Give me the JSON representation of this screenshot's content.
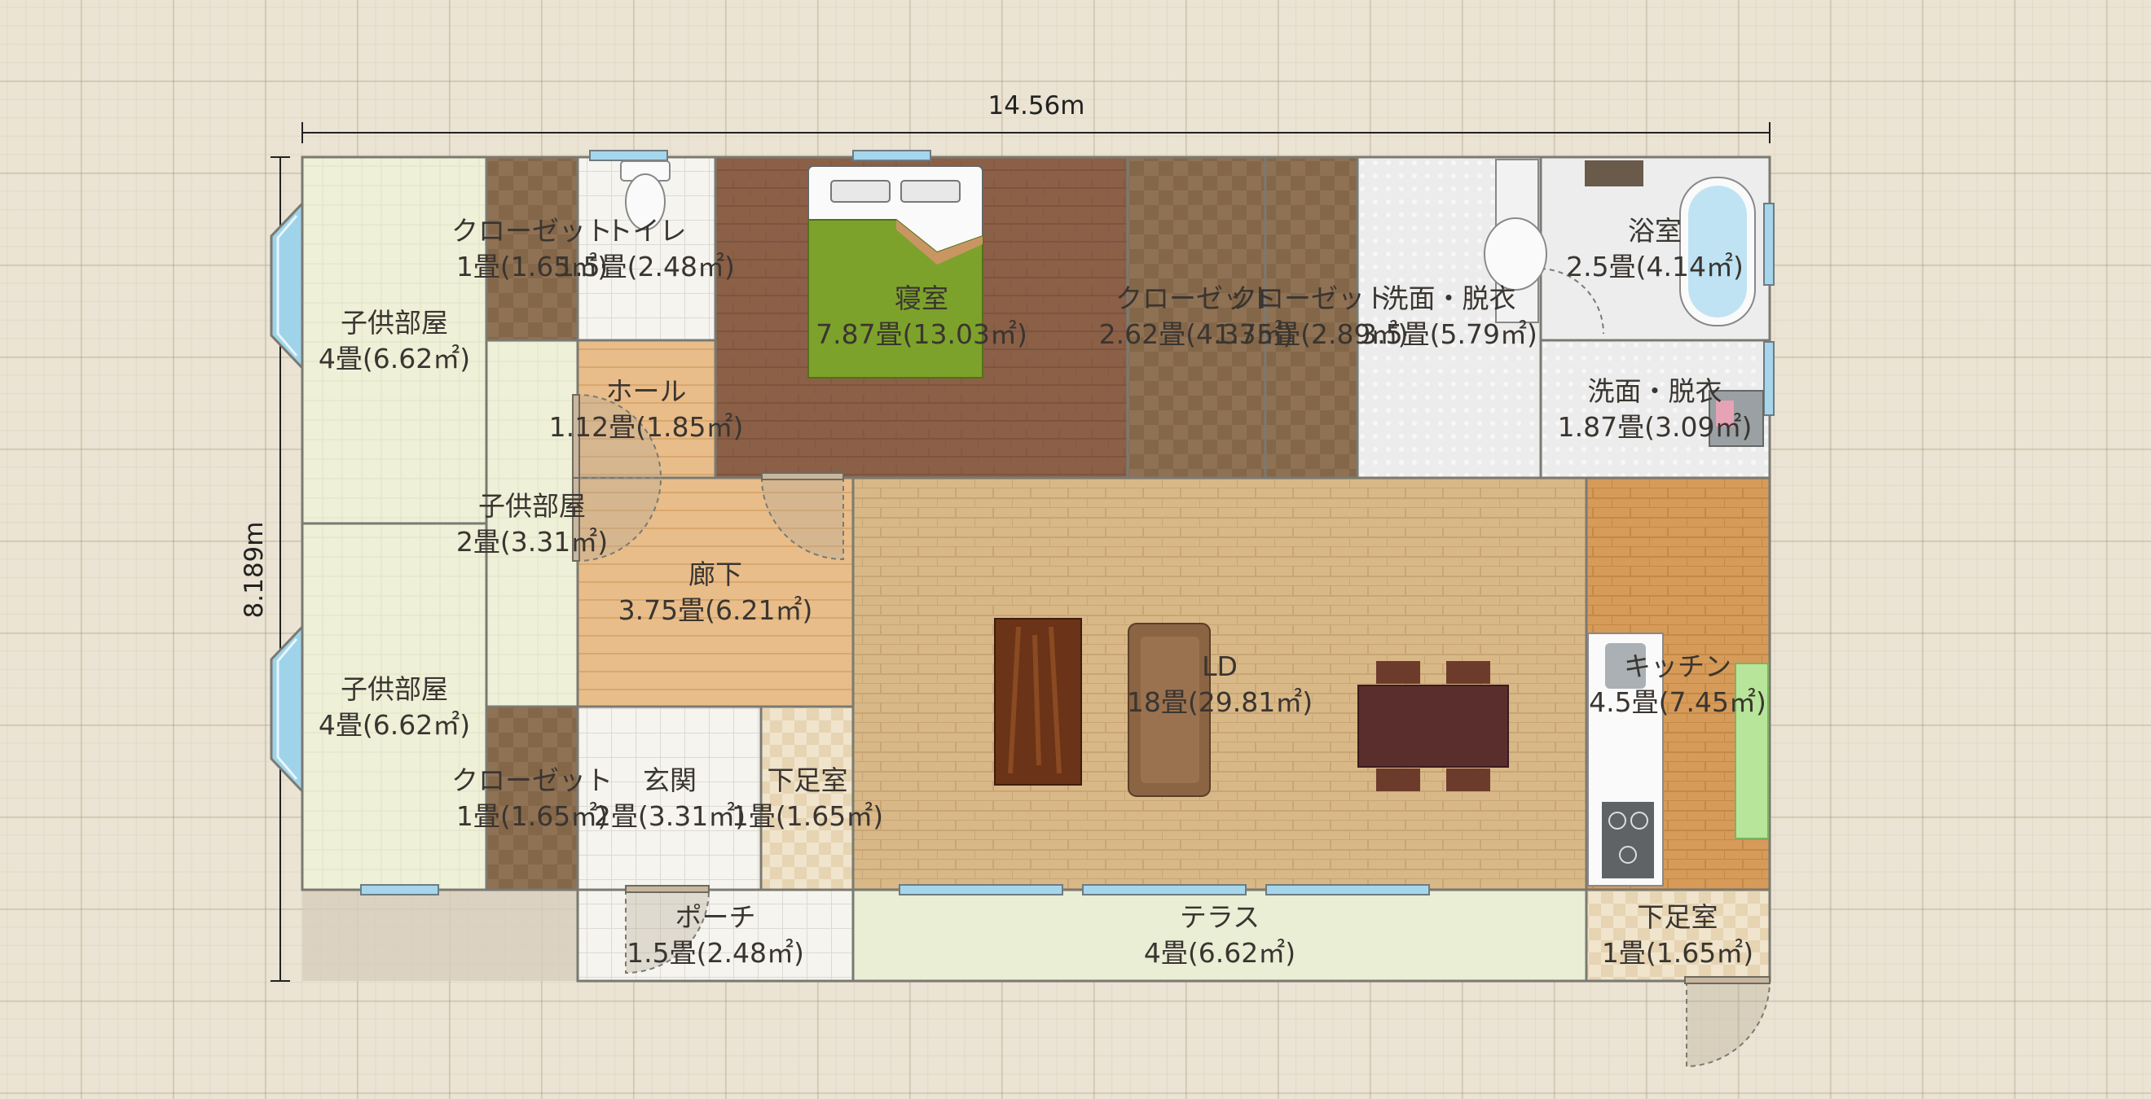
{
  "dimensions": {
    "width_label": "14.56m",
    "height_label": "8.189m"
  },
  "rooms": {
    "kodomo1": {
      "name": "子供部屋",
      "size": "4畳(6.62㎡)"
    },
    "kodomo2": {
      "name": "子供部屋",
      "size": "4畳(6.62㎡)"
    },
    "kodomo3": {
      "name": "子供部屋",
      "size": "2畳(3.31㎡)"
    },
    "closet1": {
      "name": "クローゼット",
      "size": "1畳(1.65㎡)"
    },
    "closet2": {
      "name": "クローゼット",
      "size": "1畳(1.65㎡)"
    },
    "closet3": {
      "name": "クローゼット",
      "size": "2.62畳(4.33㎡)"
    },
    "closet4": {
      "name": "クローゼット",
      "size": "1.75畳(2.89㎡)"
    },
    "toilet": {
      "name": "トイレ",
      "size": "1.5畳(2.48㎡)"
    },
    "hall": {
      "name": "ホール",
      "size": "1.12畳(1.85㎡)"
    },
    "bedroom": {
      "name": "寝室",
      "size": "7.87畳(13.03㎡)"
    },
    "senmen1": {
      "name": "洗面・脱衣",
      "size": "3.5畳(5.79㎡)"
    },
    "senmen2": {
      "name": "洗面・脱衣",
      "size": "1.87畳(3.09㎡)"
    },
    "bath": {
      "name": "浴室",
      "size": "2.5畳(4.14㎡)"
    },
    "rouka": {
      "name": "廊下",
      "size": "3.75畳(6.21㎡)"
    },
    "ld": {
      "name": "LD",
      "size": "18畳(29.81㎡)"
    },
    "kitchen": {
      "name": "キッチン",
      "size": "4.5畳(7.45㎡)"
    },
    "genkan": {
      "name": "玄関",
      "size": "2畳(3.31㎡)"
    },
    "shitaashi1": {
      "name": "下足室",
      "size": "1畳(1.65㎡)"
    },
    "shitaashi2": {
      "name": "下足室",
      "size": "1畳(1.65㎡)"
    },
    "porch": {
      "name": "ポーチ",
      "size": "1.5畳(2.48㎡)"
    },
    "terrace": {
      "name": "テラス",
      "size": "4畳(6.62㎡)"
    }
  },
  "colors": {
    "wall": "#7a7a72",
    "tatami": "#eef0d8",
    "closet": "#8f7154",
    "wood_floor": "#8b6047",
    "hall_floor": "#e8bd8a",
    "ld_floor": "#d9b888",
    "kitchen_floor": "#d69b58",
    "tile_white": "#f5f4ef",
    "terrace": "#e9eed5",
    "window": "#a6d6ec",
    "bed_cover": "#7da22b",
    "table": "#5b2e2e",
    "coffee_table": "#6b3317",
    "sofa": "#8b6443"
  }
}
